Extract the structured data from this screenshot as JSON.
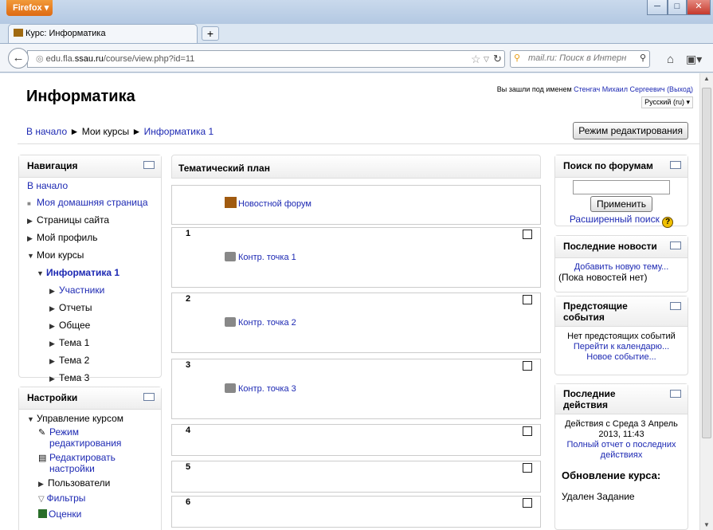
{
  "browser": {
    "app_button": "Firefox ▾",
    "tab_title": "Курс: Информатика",
    "url_prefix": "edu.fla.",
    "url_domain": "ssau.ru",
    "url_path": "/course/view.php?id=11",
    "search_placeholder": "mail.ru: Поиск в Интерн"
  },
  "header": {
    "title": "Информатика",
    "login_text": "Вы зашли под именем",
    "user_name": "Стенгач Михаил Сергеевич",
    "logout": "(Выход)",
    "language": "Русский (ru)"
  },
  "breadcrumb": {
    "home": "В начало",
    "sep": "►",
    "my_courses": "Мои курсы",
    "course": "Информатика 1"
  },
  "edit_mode_button": "Режим редактирования",
  "navigation": {
    "title": "Навигация",
    "home": "В начало",
    "my_home": "Моя домашняя страница",
    "site_pages": "Страницы сайта",
    "profile": "Мой профиль",
    "my_courses": "Мои курсы",
    "course": "Информатика 1",
    "items": [
      "Участники",
      "Отчеты",
      "Общее",
      "Тема 1",
      "Тема 2",
      "Тема 3"
    ]
  },
  "settings": {
    "title": "Настройки",
    "course_admin": "Управление курсом",
    "edit_mode_1": "Режим",
    "edit_mode_2": "редактирования",
    "edit_settings_1": "Редактировать",
    "edit_settings_2": "настройки",
    "users": "Пользователи",
    "filters": "Фильтры",
    "grades": "Оценки"
  },
  "main": {
    "title": "Тематический план",
    "news_forum": "Новостной форум",
    "sections": [
      {
        "num": "1",
        "activity": "Контр. точка 1"
      },
      {
        "num": "2",
        "activity": "Контр. точка 2"
      },
      {
        "num": "3",
        "activity": "Контр. точка 3"
      },
      {
        "num": "4",
        "activity": ""
      },
      {
        "num": "5",
        "activity": ""
      },
      {
        "num": "6",
        "activity": ""
      }
    ]
  },
  "forum_search": {
    "title": "Поиск по форумам",
    "button": "Применить",
    "advanced": "Расширенный поиск"
  },
  "latest_news": {
    "title": "Последние новости",
    "add": "Добавить новую тему...",
    "none": "(Пока новостей нет)"
  },
  "upcoming": {
    "title_1": "Предстоящие",
    "title_2": "события",
    "none": "Нет предстоящих событий",
    "calendar": "Перейти к календарю...",
    "new_event": "Новое событие..."
  },
  "recent": {
    "title_1": "Последние",
    "title_2": "действия",
    "since_1": "Действия с Среда 3 Апрель",
    "since_2": "2013, 11:43",
    "report_1": "Полный отчет о последних",
    "report_2": "действиях",
    "updates_title": "Обновление курса:",
    "removed": "Удален Задание"
  }
}
